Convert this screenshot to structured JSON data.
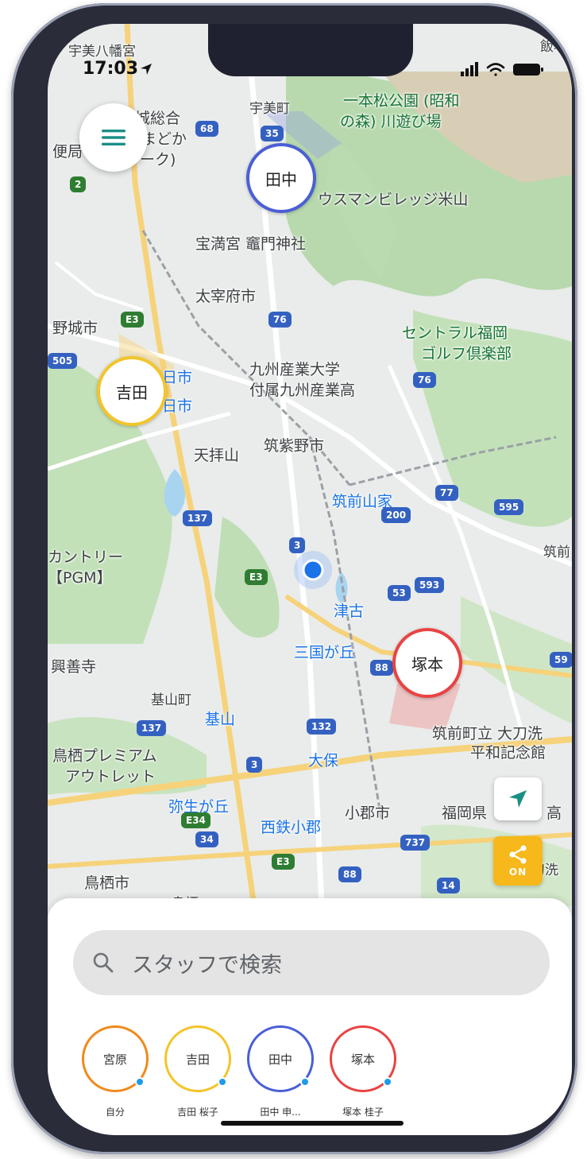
{
  "status_bar": {
    "time": "17:03"
  },
  "map": {
    "labels": [
      {
        "id": "ichihon",
        "text": "一本松公園 (昭和"
      },
      {
        "id": "ichihon2",
        "text": "の森) 川遊び場"
      },
      {
        "id": "umi",
        "text": "宇美町"
      },
      {
        "id": "housman",
        "text": "ウスマンビレッジ米山"
      },
      {
        "id": "homan",
        "text": "宝満宮 竈門神社"
      },
      {
        "id": "dazaifu",
        "text": "太宰府市"
      },
      {
        "id": "nojo",
        "text": "野城市"
      },
      {
        "id": "central",
        "text": "セントラル福岡"
      },
      {
        "id": "golf",
        "text": "ゴルフ倶楽部"
      },
      {
        "id": "kyushu",
        "text": "九州産業大学"
      },
      {
        "id": "kyushu2",
        "text": "付属九州産業高"
      },
      {
        "id": "tenpai",
        "text": "天拝山"
      },
      {
        "id": "chikushino",
        "text": "筑紫野市"
      },
      {
        "id": "chikuzenyamaie",
        "text": "筑前山家"
      },
      {
        "id": "country",
        "text": "カントリー"
      },
      {
        "id": "pgm",
        "text": "【PGM】"
      },
      {
        "id": "tsuko",
        "text": "津古"
      },
      {
        "id": "mikuni",
        "text": "三国が丘"
      },
      {
        "id": "kozenji",
        "text": "興善寺"
      },
      {
        "id": "kiyama",
        "text": "基山町"
      },
      {
        "id": "kiyama2",
        "text": "基山"
      },
      {
        "id": "tosu_outlet",
        "text": "鳥栖プレミアム"
      },
      {
        "id": "outlet",
        "text": "アウトレット"
      },
      {
        "id": "ooho",
        "text": "大保"
      },
      {
        "id": "yayoi",
        "text": "弥生が丘"
      },
      {
        "id": "ogori",
        "text": "小郡市"
      },
      {
        "id": "nishitetsu",
        "text": "西鉄小郡"
      },
      {
        "id": "fukuokaken",
        "text": "福岡県"
      },
      {
        "id": "tachiarai",
        "text": "筑前町立 大刀洗"
      },
      {
        "id": "heiwa",
        "text": "平和記念館"
      },
      {
        "id": "tosu",
        "text": "鳥栖市"
      },
      {
        "id": "tachiarai2",
        "text": "大刀洗"
      },
      {
        "id": "tosu_st",
        "text": "鳥栖"
      },
      {
        "id": "chikuzen_r",
        "text": "筑前"
      },
      {
        "id": "iizuka",
        "text": "飯塚"
      },
      {
        "id": "hi_ichi",
        "text": "日市"
      },
      {
        "id": "hi_ichi2",
        "text": "日市"
      },
      {
        "id": "koukou",
        "text": "高"
      },
      {
        "id": "left_top1",
        "text": "宇美八幡宮"
      },
      {
        "id": "left_top2",
        "text": "城総合"
      },
      {
        "id": "left_top3",
        "text": "まどか"
      },
      {
        "id": "left_top4",
        "text": "便局"
      },
      {
        "id": "left_top5",
        "text": "ーク)"
      }
    ],
    "roads": [
      "68",
      "35",
      "2",
      "E3",
      "505",
      "76",
      "76",
      "77",
      "595",
      "137",
      "200",
      "3",
      "E3",
      "53",
      "593",
      "88",
      "59",
      "137",
      "132",
      "3",
      "E34",
      "34",
      "737",
      "E3",
      "88",
      "14"
    ]
  },
  "staff_markers": [
    {
      "name": "田中",
      "color": "#4a5fd6"
    },
    {
      "name": "吉田",
      "color": "#f3c52a"
    },
    {
      "name": "塚本",
      "color": "#e94343"
    }
  ],
  "controls": {
    "share_state": "ON"
  },
  "search": {
    "placeholder": "スタッフで検索"
  },
  "staff_list": [
    {
      "short": "宮原",
      "label": "自分",
      "color": "#f08a1c"
    },
    {
      "short": "吉田",
      "label": "吉田 桜子",
      "color": "#f3c52a"
    },
    {
      "short": "田中",
      "label": "田中 申...",
      "color": "#4a5fd6"
    },
    {
      "short": "塚本",
      "label": "塚本 桂子",
      "color": "#e94343"
    }
  ],
  "icons": [
    "menu-icon",
    "location-arrow-icon",
    "share-icon",
    "search-icon",
    "signal-icon",
    "wifi-icon",
    "battery-icon"
  ]
}
